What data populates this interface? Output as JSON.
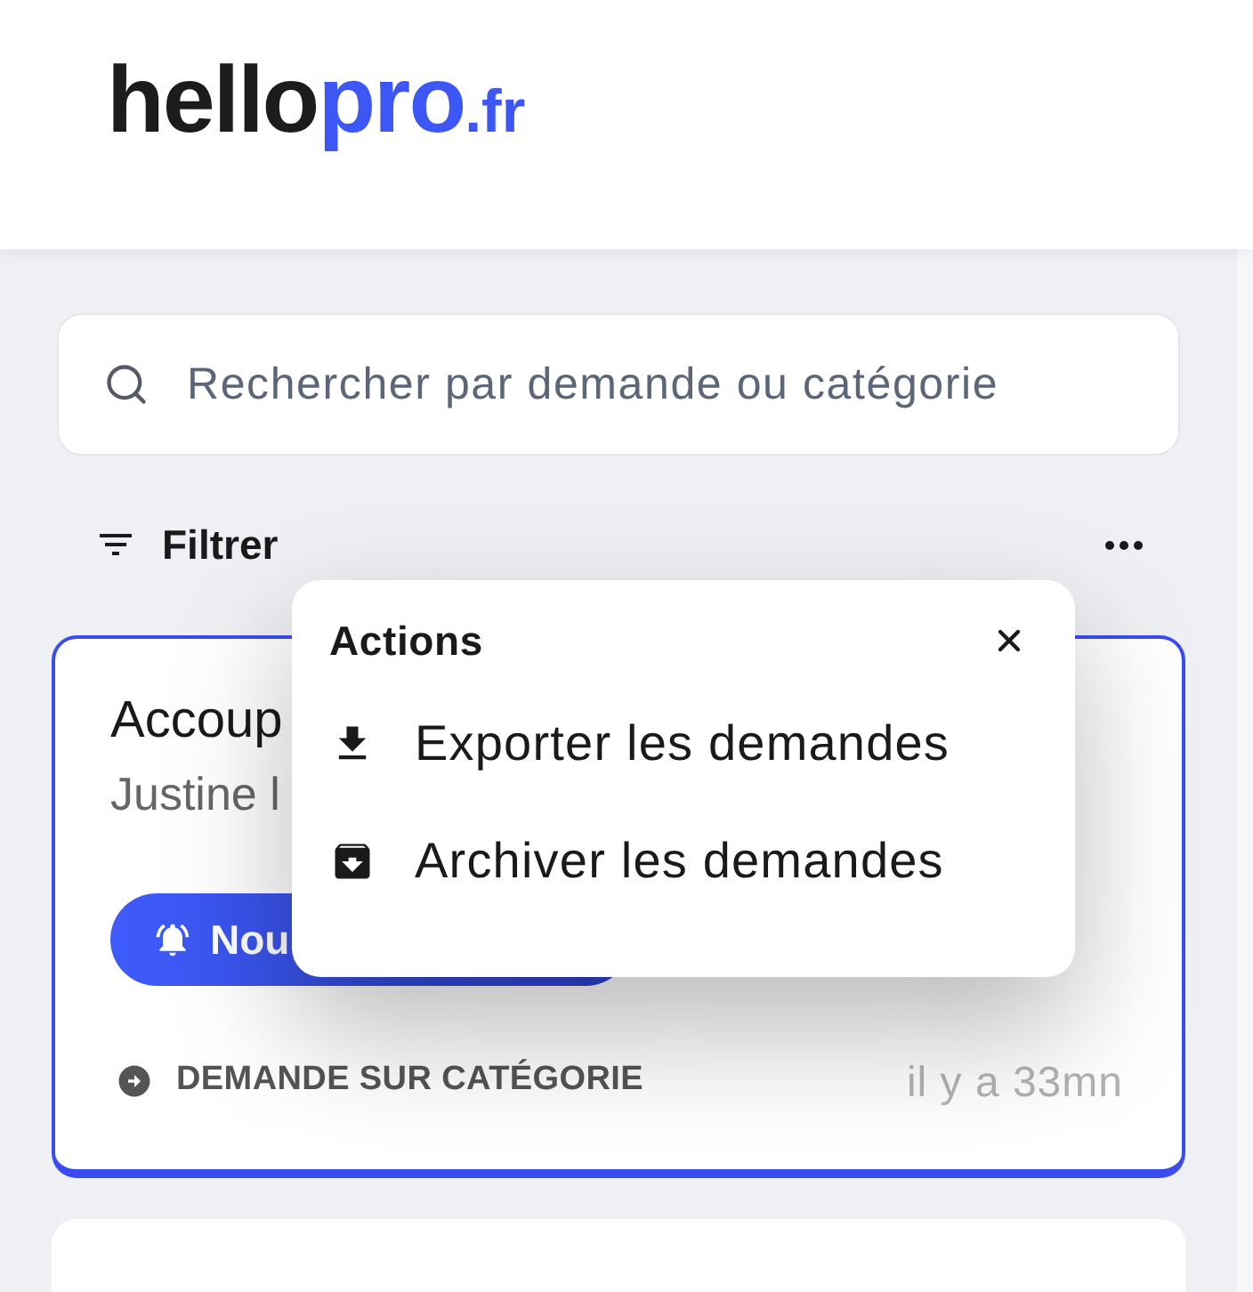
{
  "header": {
    "logo": {
      "part_1": "hello",
      "part_2": "pro",
      "part_3": ".fr"
    }
  },
  "search": {
    "placeholder": "Rechercher par demande ou catégorie"
  },
  "toolbar": {
    "filter_label": "Filtrer"
  },
  "requests": [
    {
      "title": "Accoup",
      "requester": "Justine l",
      "badge": "Nou",
      "source": "DEMANDE SUR CATÉGORIE",
      "time": "il y a 33mn",
      "selected": true
    },
    {
      "selected": false
    }
  ],
  "actions_menu": {
    "open": true,
    "title": "Actions",
    "items": [
      {
        "kind": "export",
        "label": "Exporter les demandes"
      },
      {
        "kind": "archive",
        "label": "Archiver les demandes"
      }
    ]
  }
}
